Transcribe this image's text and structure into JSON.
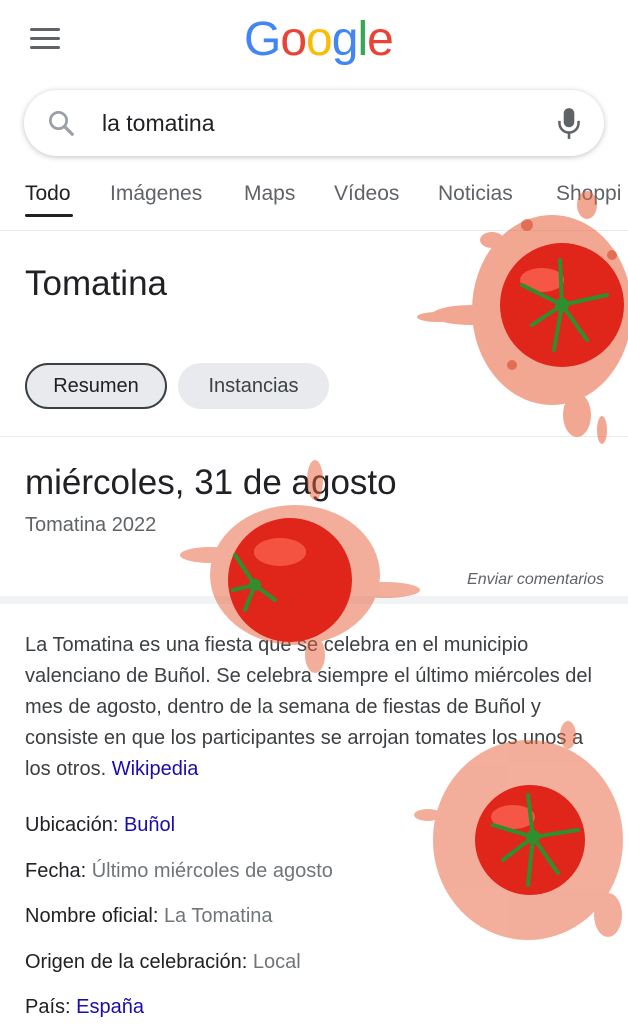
{
  "header": {
    "logo_letters": [
      {
        "ch": "G",
        "color": "#4285F4"
      },
      {
        "ch": "o",
        "color": "#EA4335"
      },
      {
        "ch": "o",
        "color": "#FBBC05"
      },
      {
        "ch": "g",
        "color": "#4285F4"
      },
      {
        "ch": "l",
        "color": "#34A853"
      },
      {
        "ch": "e",
        "color": "#EA4335"
      }
    ],
    "menu_icon": "hamburger-menu-icon"
  },
  "search": {
    "query": "la tomatina",
    "search_icon": "search-icon",
    "mic_icon": "microphone-icon"
  },
  "tabs": [
    {
      "label": "Todo",
      "active": true
    },
    {
      "label": "Imágenes",
      "active": false
    },
    {
      "label": "Maps",
      "active": false
    },
    {
      "label": "Vídeos",
      "active": false
    },
    {
      "label": "Noticias",
      "active": false
    },
    {
      "label": "Shoppi",
      "active": false
    }
  ],
  "panel": {
    "title": "Tomatina",
    "chips": [
      "Resumen",
      "Instancias"
    ],
    "date": "miércoles, 31 de agosto",
    "date_sub": "Tomatina 2022",
    "feedback": "Enviar comentarios",
    "description": "La Tomatina es una fiesta que se celebra en el municipio valenciano de Buñol. Se celebra siempre el último miércoles del mes de agosto, dentro de la semana de fiestas de Buñol y consiste en que los participantes se arrojan tomates los unos a los otros. ",
    "description_link": "Wikipedia",
    "facts": [
      {
        "label": "Ubicación: ",
        "value": "Buñol",
        "link": true
      },
      {
        "label": "Fecha: ",
        "value": "Último miércoles de agosto",
        "link": false
      },
      {
        "label": "Nombre oficial: ",
        "value": "La Tomatina",
        "link": false
      },
      {
        "label": "Origen de la celebración: ",
        "value": "Local",
        "link": false
      },
      {
        "label": "País: ",
        "value": "España",
        "link": true
      }
    ]
  },
  "colors": {
    "link": "#1a0dab",
    "tomato": "#e0261b",
    "splat": "#e8603a"
  }
}
